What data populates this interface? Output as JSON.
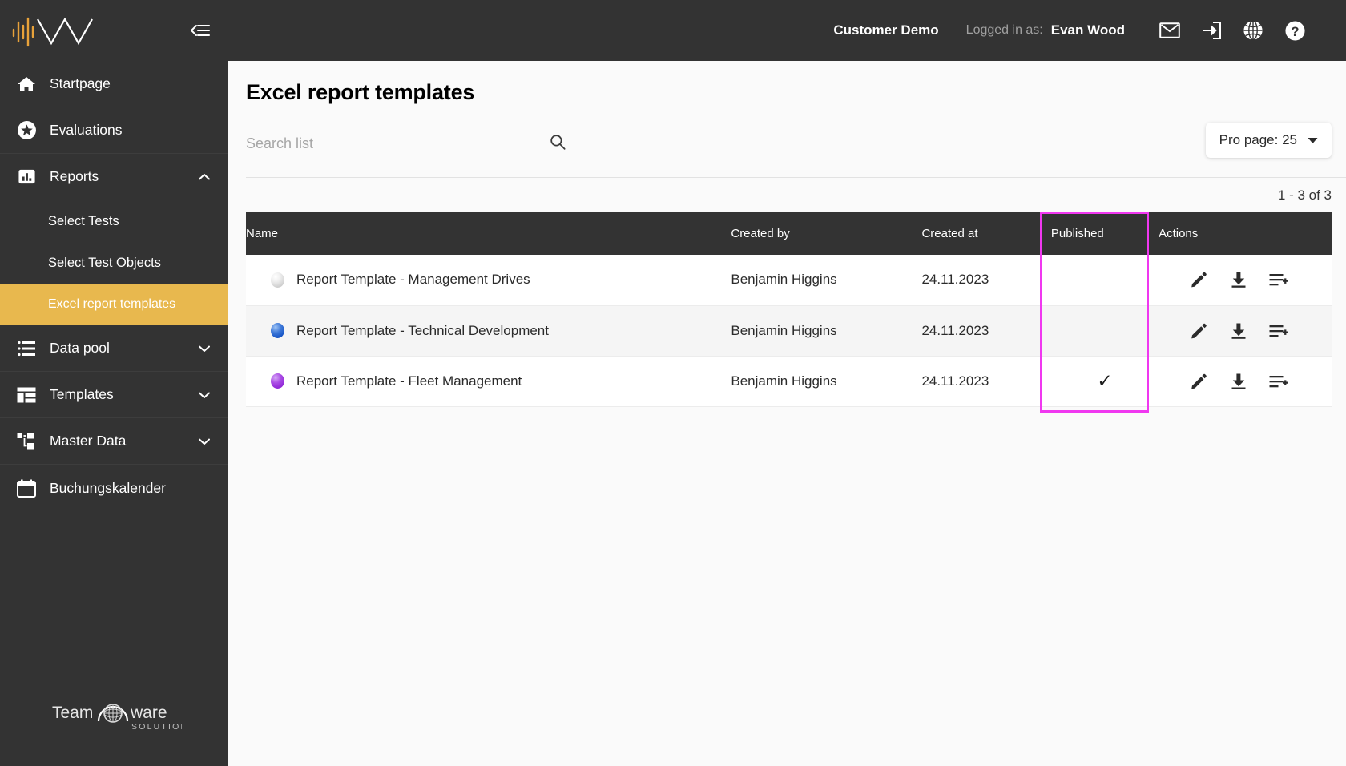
{
  "sidebar": {
    "logo_name": "waveform-logo",
    "collapse_icon": "collapse-sidebar-icon",
    "items": [
      {
        "label": "Startpage",
        "icon": "home-icon",
        "type": "item",
        "expandable": false
      },
      {
        "label": "Evaluations",
        "icon": "star-circle-icon",
        "type": "item",
        "expandable": false
      },
      {
        "label": "Reports",
        "icon": "bar-chart-icon",
        "type": "item",
        "expandable": true,
        "expanded": true,
        "chevron": "chevron-up-icon"
      },
      {
        "label": "Select Tests",
        "type": "sub",
        "active": false
      },
      {
        "label": "Select Test Objects",
        "type": "sub",
        "active": false
      },
      {
        "label": "Excel report templates",
        "type": "sub",
        "active": true
      },
      {
        "label": "Data pool",
        "icon": "list-icon",
        "type": "item",
        "expandable": true,
        "expanded": false,
        "chevron": "chevron-down-icon"
      },
      {
        "label": "Templates",
        "icon": "layout-icon",
        "type": "item",
        "expandable": true,
        "expanded": false,
        "chevron": "chevron-down-icon"
      },
      {
        "label": "Master Data",
        "icon": "hierarchy-icon",
        "type": "item",
        "expandable": true,
        "expanded": false,
        "chevron": "chevron-down-icon"
      },
      {
        "label": "Buchungskalender",
        "icon": "calendar-icon",
        "type": "item",
        "expandable": false
      }
    ],
    "footer_logo": {
      "text_left": "Team",
      "text_right": "ware",
      "subtitle": "SOLUTIONS"
    }
  },
  "topbar": {
    "customer": "Customer Demo",
    "logged_in_label": "Logged in as:",
    "username": "Evan Wood",
    "icons": [
      "mail-icon",
      "logout-icon",
      "globe-icon",
      "help-icon"
    ]
  },
  "page": {
    "title": "Excel report templates",
    "search_placeholder": "Search list",
    "search_value": "",
    "search_icon": "search-icon",
    "per_page_label": "Pro page: 25",
    "per_page_value": "25",
    "result_count": "1 - 3 of 3"
  },
  "table": {
    "columns": [
      "Name",
      "Created by",
      "Created at",
      "Published",
      "Actions"
    ],
    "rows": [
      {
        "dot_color": "#d0d0d0",
        "dot_class": "dot-grey",
        "name": "Report Template - Management Drives",
        "created_by": "Benjamin Higgins",
        "created_at": "24.11.2023",
        "published": false,
        "published_mark": ""
      },
      {
        "dot_color": "#1452c4",
        "dot_class": "dot-blue",
        "name": "Report Template - Technical Development",
        "created_by": "Benjamin Higgins",
        "created_at": "24.11.2023",
        "published": false,
        "published_mark": ""
      },
      {
        "dot_color": "#8f26d6",
        "dot_class": "dot-purple",
        "name": "Report Template - Fleet Management",
        "created_by": "Benjamin Higgins",
        "created_at": "24.11.2023",
        "published": true,
        "published_mark": "✓"
      }
    ],
    "row_actions": [
      "edit-icon",
      "download-icon",
      "add-to-list-icon"
    ]
  },
  "annotation": {
    "highlight_color": "#f038f0",
    "highlight_target": "published-column"
  },
  "colors": {
    "sidebar_bg": "#333333",
    "accent": "#e8b84e",
    "page_bg": "#fafafa",
    "table_header_bg": "#333333"
  }
}
